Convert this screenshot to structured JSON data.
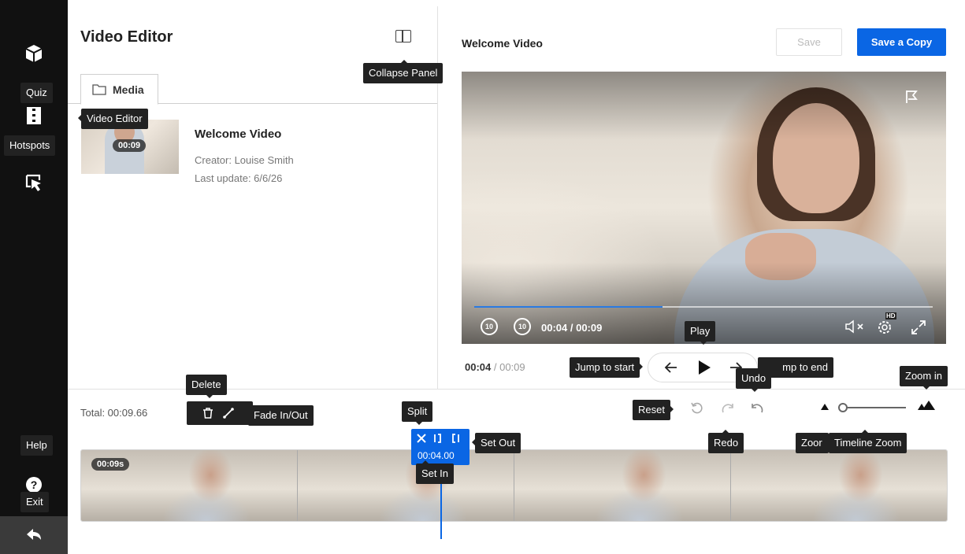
{
  "rail": {
    "quiz_label": "Quiz",
    "hotspots_label": "Hotspots",
    "help_label": "Help",
    "exit_label": "Exit",
    "help_glyph": "?"
  },
  "left_panel": {
    "title": "Video Editor",
    "tab_media": "Media",
    "media_item": {
      "duration": "00:09",
      "title": "Welcome Video",
      "creator": "Creator: Louise Smith",
      "last_update": "Last update: 6/6/26"
    }
  },
  "player": {
    "video_title": "Welcome Video",
    "save_label": "Save",
    "save_copy_label": "Save a Copy",
    "time_display": "00:04 / 00:09",
    "current_time": "00:04",
    "separator": " / ",
    "duration": "00:09",
    "progress_fraction": 0.41,
    "skip_back_label": "10",
    "skip_fwd_label": "10",
    "hd_label": "HD"
  },
  "timeline": {
    "total_label": "Total: 00:09.66",
    "clip_badge": "00:09s",
    "split_time": "00:04.00"
  },
  "tooltips": {
    "quiz": "Quiz",
    "video_editor": "Video Editor",
    "hotspots": "Hotspots",
    "collapse_panel": "Collapse Panel",
    "play": "Play",
    "jump_to_start": "Jump to start",
    "jump_to_end": "mp to end",
    "undo": "Undo",
    "zoom_in": "Zoom in",
    "delete": "Delete",
    "fade": "Fade In/Out",
    "split": "Split",
    "set_out": "Set Out",
    "set_in": "Set In",
    "reset": "Reset",
    "redo": "Redo",
    "zoom_out_partial": "Zoor",
    "timeline_zoom": "Timeline Zoom",
    "help": "Help",
    "exit": "Exit"
  },
  "colors": {
    "accent": "#0a66e4",
    "rail_bg": "#111111",
    "tooltip_bg": "#222222"
  }
}
